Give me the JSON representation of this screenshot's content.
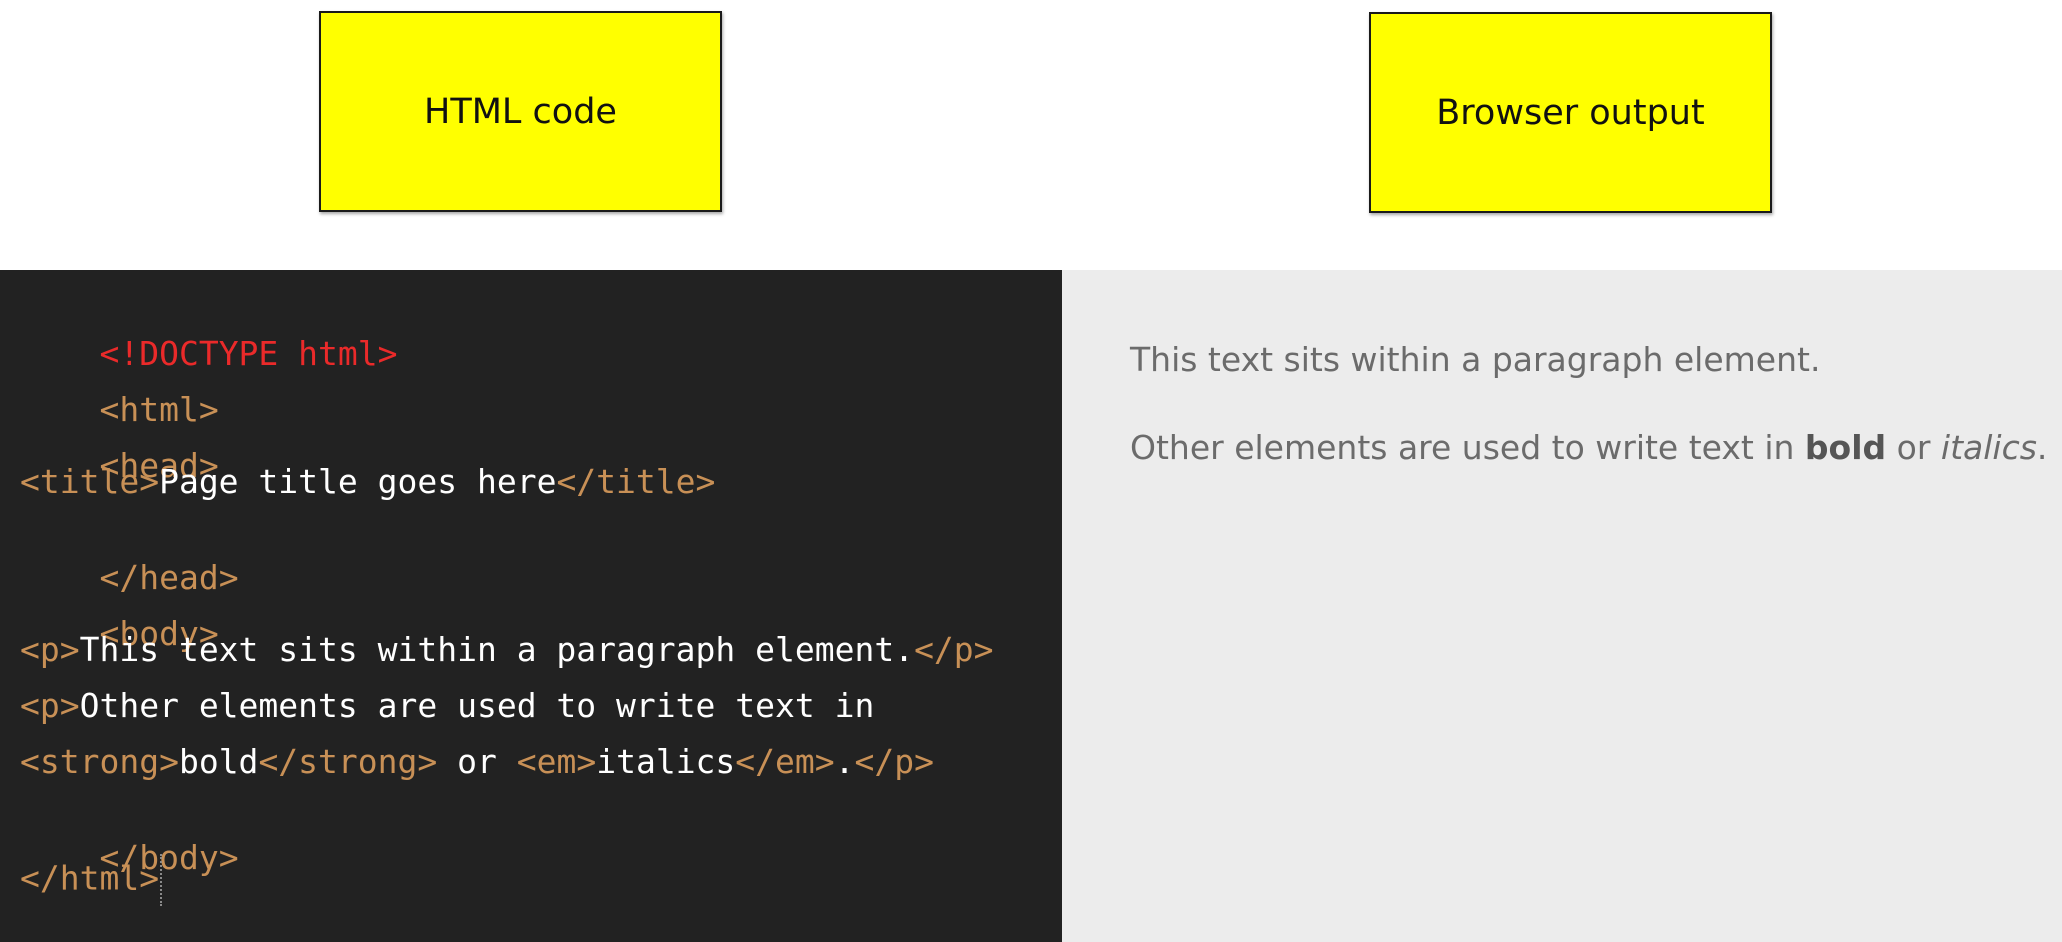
{
  "labels": {
    "code_label": "HTML code",
    "output_label": "Browser output"
  },
  "colors": {
    "label_bg": "#ffff00",
    "code_bg": "#222222",
    "tag": "#c89056",
    "doctype": "#ea2a2a",
    "code_text": "#ffffff",
    "output_bg": "#ececec",
    "output_text": "#6b6b6b"
  },
  "code": {
    "doctype": "<!DOCTYPE html>",
    "html_open": "<html>",
    "head_open": "<head>",
    "title_open": "<title>",
    "title_text": "Page title goes here",
    "title_close": "</title>",
    "head_close": "</head>",
    "body_open": "<body>",
    "p_open": "<p>",
    "p1_text": "This text sits within a paragraph element.",
    "p_close": "</p>",
    "p2_text": "Other elements are used to write text in",
    "strong_open": "<strong>",
    "strong_text": "bold",
    "strong_close": "</strong>",
    "or_text": " or ",
    "em_open": "<em>",
    "em_text": "italics",
    "em_close": "</em>",
    "period": ".",
    "body_close": "</body>",
    "html_close": "</html>"
  },
  "output": {
    "p1": "This text sits within a paragraph element.",
    "p2_prefix": "Other elements are used to write text in ",
    "p2_bold": "bold",
    "p2_or": " or ",
    "p2_italic": "italics",
    "p2_period": "."
  }
}
